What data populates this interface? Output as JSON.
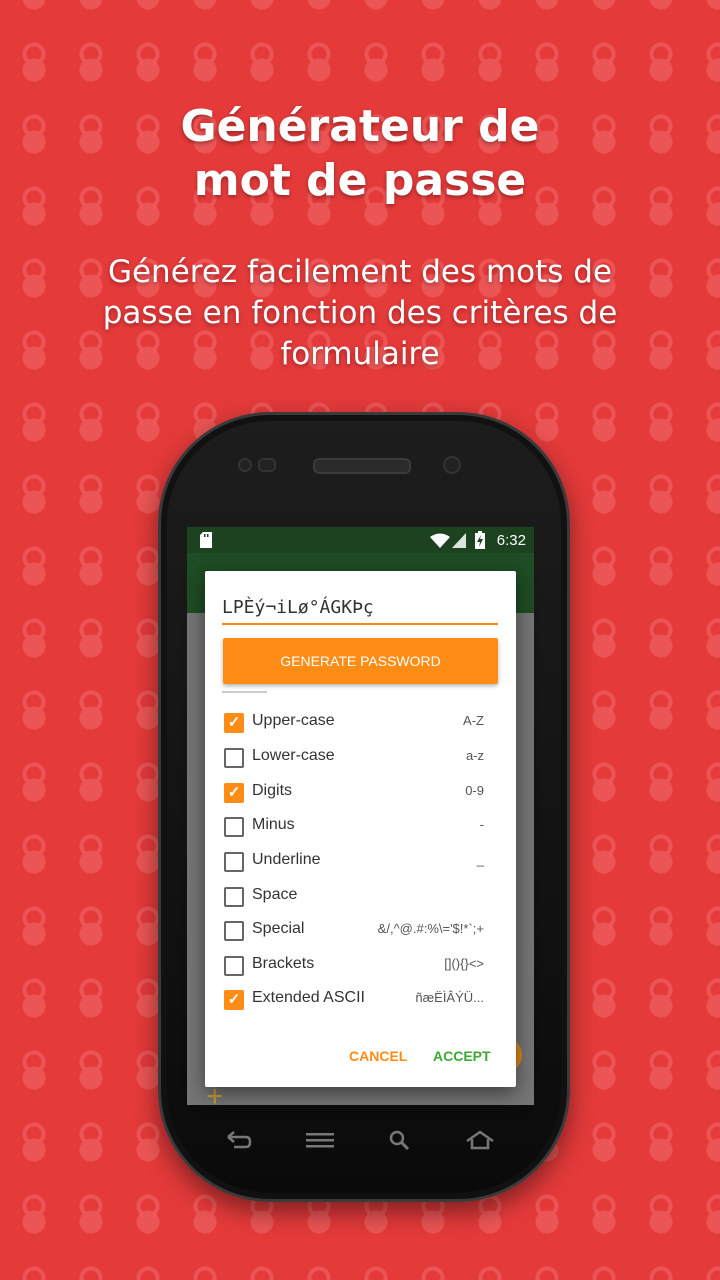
{
  "promo": {
    "title_line1": "Générateur de",
    "title_line2": "mot de passe",
    "subtitle_line1": "Générez facilement des mots de",
    "subtitle_line2": "passe en fonction des critères de",
    "subtitle_line3": "formulaire"
  },
  "status_bar": {
    "time": "6:32",
    "icons": [
      "sd-card-icon",
      "wifi-icon",
      "signal-icon",
      "battery-icon"
    ]
  },
  "dialog": {
    "password_value": "LPÈý¬iLø°ÁGKÞç",
    "generate_label": "GENERATE PASSWORD",
    "options": [
      {
        "label": "Upper-case",
        "chars": "A-Z",
        "checked": true
      },
      {
        "label": "Lower-case",
        "chars": "a-z",
        "checked": false
      },
      {
        "label": "Digits",
        "chars": "0-9",
        "checked": true
      },
      {
        "label": "Minus",
        "chars": "-",
        "checked": false
      },
      {
        "label": "Underline",
        "chars": "_",
        "checked": false
      },
      {
        "label": "Space",
        "chars": "",
        "checked": false
      },
      {
        "label": "Special",
        "chars": "&/,^@.#:%\\='$!*`;+",
        "checked": false
      },
      {
        "label": "Brackets",
        "chars": "[](){}<>",
        "checked": false
      },
      {
        "label": "Extended ASCII",
        "chars": "ñæËÌÂÝÜ...",
        "checked": true
      }
    ],
    "cancel_label": "CANCEL",
    "accept_label": "ACCEPT"
  },
  "colors": {
    "background": "#e53a3a",
    "accent": "#ff8c14",
    "accept": "#3aaa35",
    "appbar": "#1f4d24"
  }
}
